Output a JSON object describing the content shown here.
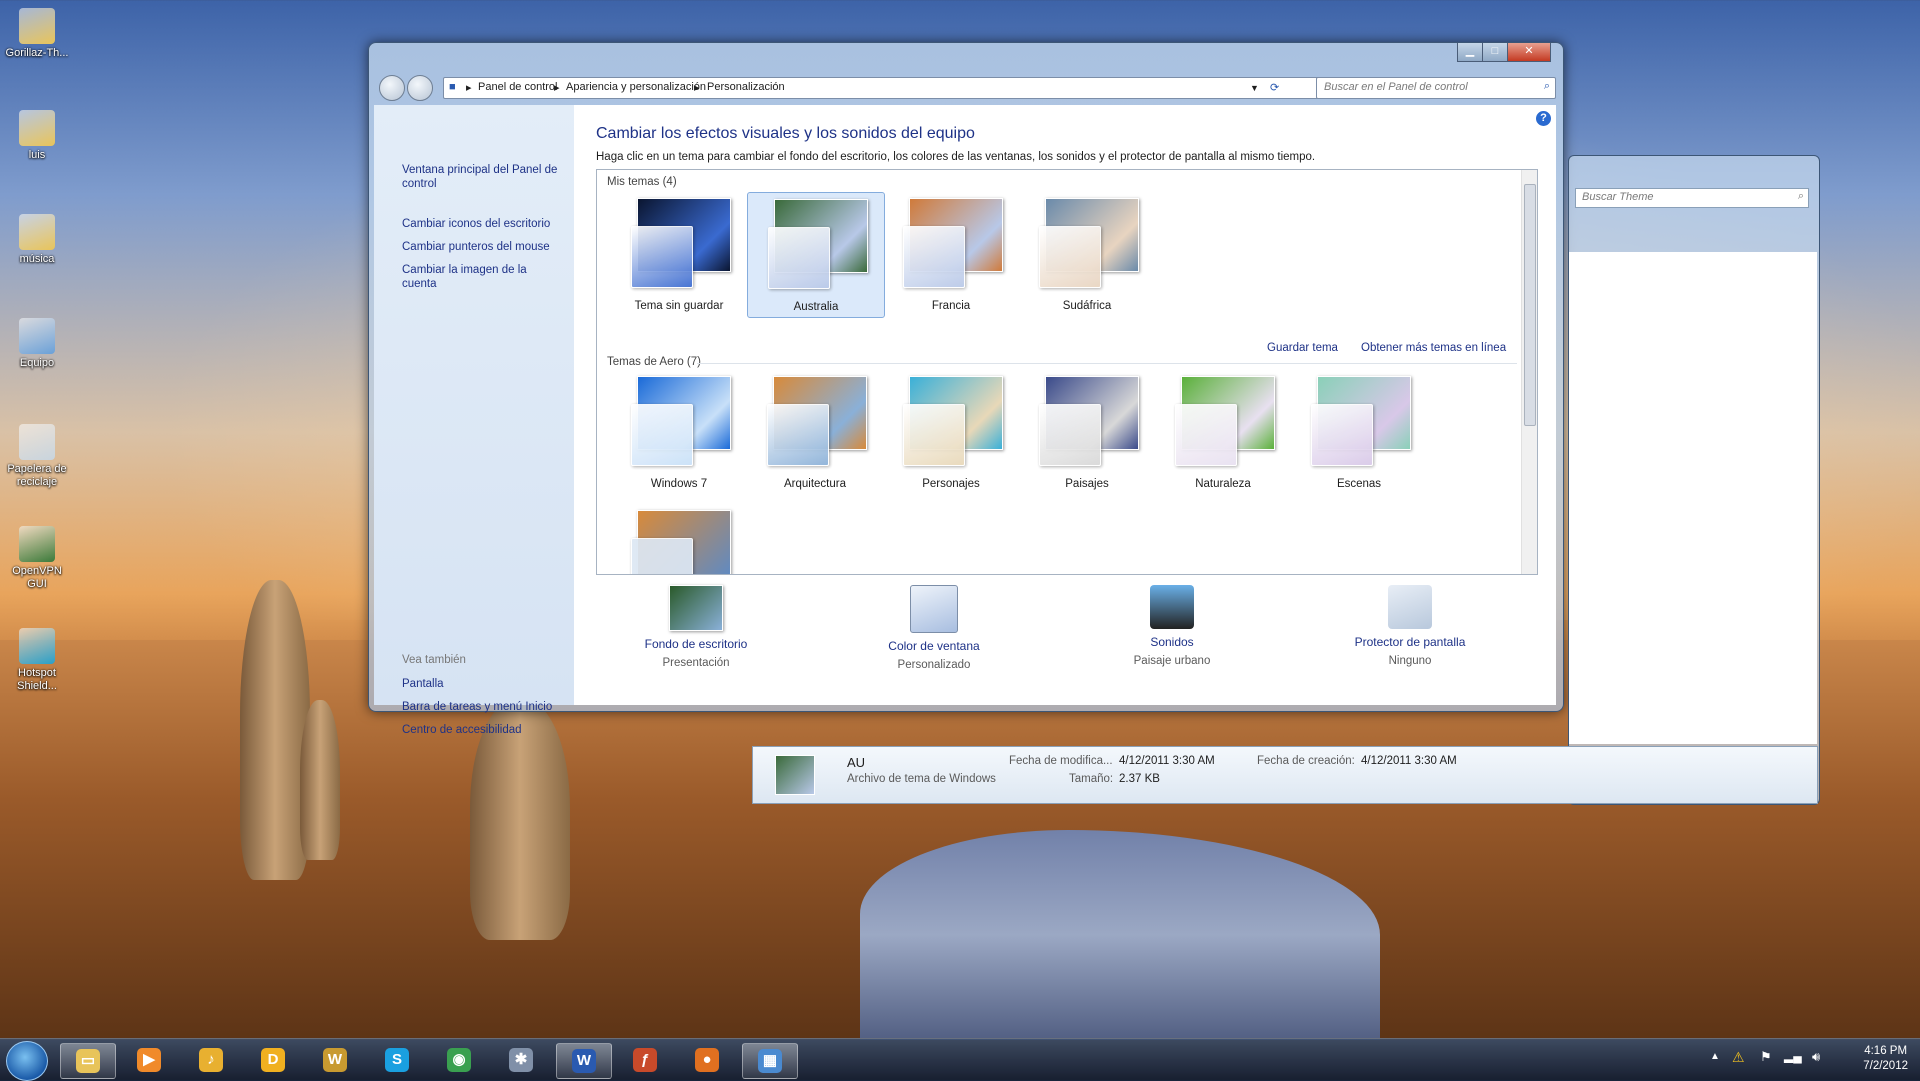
{
  "desktop": {
    "icons": [
      {
        "label": "Gorillaz-Th...",
        "icon": "folder-icon",
        "color": "#e8c45a"
      },
      {
        "label": "luis",
        "icon": "user-folder-icon",
        "color": "#e8c45a"
      },
      {
        "label": "música",
        "icon": "music-folder-icon",
        "color": "#e8c45a"
      },
      {
        "label": "Equipo",
        "icon": "computer-icon",
        "color": "#6aa0d8"
      },
      {
        "label": "Papelera de reciclaje",
        "icon": "recycle-bin-icon",
        "color": "#c8d4de"
      },
      {
        "label": "OpenVPN GUI",
        "icon": "network-icon",
        "color": "#3a7a3a"
      },
      {
        "label": "Hotspot Shield...",
        "icon": "shield-icon",
        "color": "#2aa0c8"
      }
    ]
  },
  "window": {
    "breadcrumb": [
      "Panel de control",
      "Apariencia y personalización",
      "Personalización"
    ],
    "search_placeholder": "Buscar en el Panel de control",
    "left_links": [
      "Ventana principal del Panel de control",
      "Cambiar iconos del escritorio",
      "Cambiar punteros del mouse",
      "Cambiar la imagen de la cuenta"
    ],
    "see_also_title": "Vea también",
    "see_also_links": [
      "Pantalla",
      "Barra de tareas y menú Inicio",
      "Centro de accesibilidad"
    ],
    "heading": "Cambiar los efectos visuales y los sonidos del equipo",
    "description": "Haga clic en un tema para cambiar el fondo del escritorio, los colores de las ventanas, los sonidos y el protector de pantalla al mismo tiempo.",
    "my_themes_title": "Mis temas (4)",
    "my_themes": [
      {
        "label": "Tema sin guardar",
        "selected": false,
        "colors": [
          "#0a1530",
          "#3a6ad0"
        ]
      },
      {
        "label": "Australia",
        "selected": true,
        "colors": [
          "#3a6a3a",
          "#b8c8e8"
        ]
      },
      {
        "label": "Francia",
        "selected": false,
        "colors": [
          "#d07a3a",
          "#b8c8e8"
        ]
      },
      {
        "label": "Sudáfrica",
        "selected": false,
        "colors": [
          "#6a8aaa",
          "#e8d4c0"
        ]
      }
    ],
    "save_theme": "Guardar tema",
    "more_themes": "Obtener más temas en línea",
    "aero_themes_title": "Temas de Aero (7)",
    "aero_themes": [
      {
        "label": "Windows 7",
        "colors": [
          "#1a6ad8",
          "#c8e0f8"
        ]
      },
      {
        "label": "Arquitectura",
        "colors": [
          "#d88a3a",
          "#8ab0d8"
        ]
      },
      {
        "label": "Personajes",
        "colors": [
          "#3ab0d8",
          "#e8d8b8"
        ]
      },
      {
        "label": "Paisajes",
        "colors": [
          "#3a4a8a",
          "#d8d8d8"
        ]
      },
      {
        "label": "Naturaleza",
        "colors": [
          "#5ab03a",
          "#e8e0f0"
        ]
      },
      {
        "label": "Escenas",
        "colors": [
          "#8ad0b8",
          "#d8c8e8"
        ]
      }
    ],
    "bottom_items": [
      {
        "title": "Fondo de escritorio",
        "sub": "Presentación",
        "icon": "desktop-background-icon"
      },
      {
        "title": "Color de ventana",
        "sub": "Personalizado",
        "icon": "window-color-icon"
      },
      {
        "title": "Sonidos",
        "sub": "Paisaje urbano",
        "icon": "sounds-icon"
      },
      {
        "title": "Protector de pantalla",
        "sub": "Ninguno",
        "icon": "screensaver-icon"
      }
    ]
  },
  "explorer": {
    "search_placeholder": "Buscar Theme",
    "file_name": "AU",
    "file_type": "Archivo de tema de Windows",
    "modified_label": "Fecha de modifica...",
    "modified_value": "4/12/2011 3:30 AM",
    "created_label": "Fecha de creación:",
    "created_value": "4/12/2011 3:30 AM",
    "size_label": "Tamaño:",
    "size_value": "2.37 KB"
  },
  "taskbar": {
    "apps": [
      {
        "name": "explorer",
        "glyph": "▭",
        "color": "#e8c45a",
        "open": true
      },
      {
        "name": "media-player",
        "glyph": "▶",
        "color": "#f08a2a",
        "open": false
      },
      {
        "name": "music",
        "glyph": "♪",
        "color": "#e8b030",
        "open": false
      },
      {
        "name": "d-app",
        "glyph": "D",
        "color": "#f0b020",
        "open": false
      },
      {
        "name": "wow",
        "glyph": "W",
        "color": "#c89a30",
        "open": false
      },
      {
        "name": "skype",
        "glyph": "S",
        "color": "#1aa0e0",
        "open": false
      },
      {
        "name": "chrome",
        "glyph": "◉",
        "color": "#3aa050",
        "open": false
      },
      {
        "name": "tool",
        "glyph": "✱",
        "color": "#8090a8",
        "open": false
      },
      {
        "name": "word",
        "glyph": "W",
        "color": "#2a5ab0",
        "open": true
      },
      {
        "name": "flash",
        "glyph": "ƒ",
        "color": "#c84a2a",
        "open": false
      },
      {
        "name": "firefox",
        "glyph": "●",
        "color": "#e07020",
        "open": false
      },
      {
        "name": "control-panel",
        "glyph": "▦",
        "color": "#4a8ad0",
        "open": true
      }
    ],
    "time": "4:16 PM",
    "date": "7/2/2012"
  }
}
